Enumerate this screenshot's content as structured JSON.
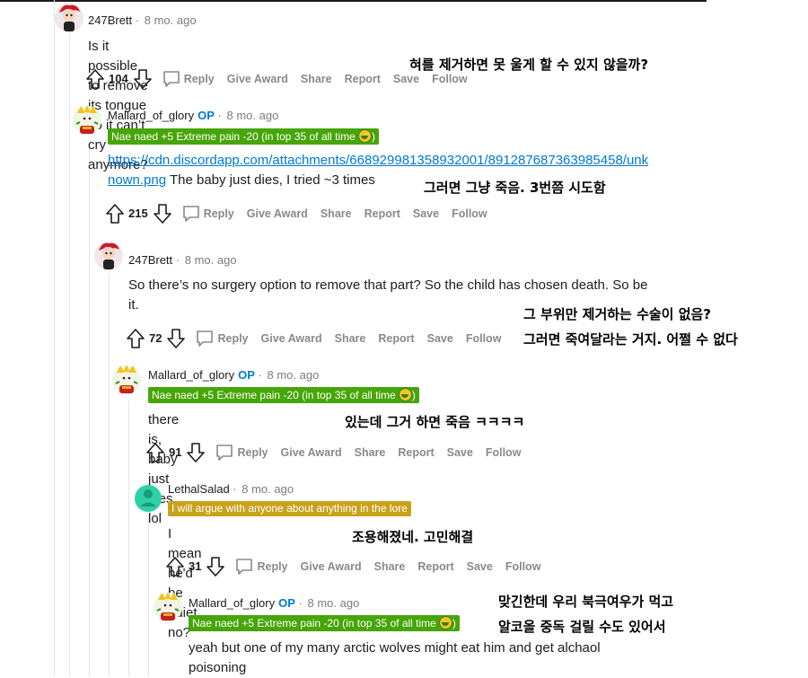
{
  "actions": {
    "reply": "Reply",
    "give_award": "Give Award",
    "share": "Share",
    "report": "Report",
    "save": "Save",
    "follow": "Follow"
  },
  "flairs": {
    "mallard": "Nae naed +5 Extreme pain -20 (in top 35 of all time",
    "lethal": "I will argue with anyone about anything in the lore"
  },
  "comments": [
    {
      "user": "247Brett",
      "op": "",
      "time": "8 mo. ago",
      "body": "Is it possible to remove its tongue so it can’t cry anymore?",
      "votes": "104",
      "translation": [
        "혀를 제거하면 못 울게 할 수 있지 않을까?"
      ]
    },
    {
      "user": "Mallard_of_glory",
      "op": "OP",
      "time": "8 mo. ago",
      "link": "https://cdn.discordapp.com/attachments/668929981358932001/891287687363985458/unknown.png",
      "link_line1": "https://cdn.discordapp.com/attachments/668929981358932001/891287687363985458/unk",
      "link_line2": "nown.png",
      "body": " The baby just dies, I tried ~3 times",
      "votes": "215",
      "translation": [
        "그러면 그냥 죽음. 3번쯤 시도함"
      ]
    },
    {
      "user": "247Brett",
      "op": "",
      "time": "8 mo. ago",
      "body_line1": "So there’s no surgery option to remove that part? So the child has chosen death. So be",
      "body_line2": "it.",
      "votes": "72",
      "translation": [
        "그 부위만 제거하는 수술이 없음?",
        "그러면 죽여달라는 거지. 어쩔 수 없다"
      ]
    },
    {
      "user": "Mallard_of_glory",
      "op": "OP",
      "time": "8 mo. ago",
      "body": "there is, baby just dies lol",
      "votes": "91",
      "translation": [
        "있는데 그거 하면 죽음 ㅋㅋㅋㅋ"
      ]
    },
    {
      "user": "LethalSalad",
      "op": "",
      "time": "8 mo. ago",
      "body": "I mean he'd be quiet, no?",
      "votes": "31",
      "translation": [
        "조용해졌네. 고민해결"
      ]
    },
    {
      "user": "Mallard_of_glory",
      "op": "OP",
      "time": "8 mo. ago",
      "body_line1": "yeah but one of my many arctic wolves might eat him and get alchaol",
      "body_line2": "poisoning",
      "translation": [
        "맞긴한데 우리 북극여우가 먹고",
        "알코올 중독 걸릴 수도 있어서"
      ]
    }
  ],
  "colors": {
    "link": "#0079d3",
    "op": "#0079d3",
    "flair_green": "#46a508",
    "flair_gold": "#c9a21c",
    "meta_gray": "#7c7c7c",
    "action_gray": "#878a8c"
  }
}
